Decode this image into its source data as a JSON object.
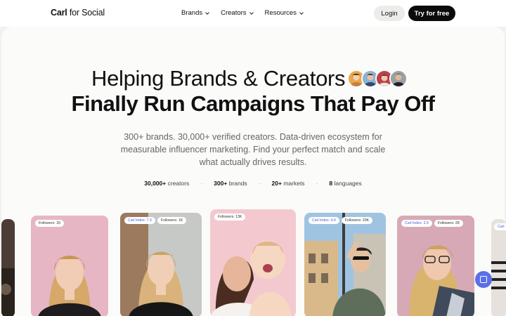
{
  "nav": {
    "logo_bold": "Carl",
    "logo_rest": "for Social",
    "menu": [
      {
        "label": "Brands"
      },
      {
        "label": "Creators"
      },
      {
        "label": "Resources"
      }
    ],
    "login_label": "Login",
    "cta_label": "Try for free"
  },
  "hero": {
    "headline_line1": "Helping Brands & Creators",
    "headline_line2": "Finally Run Campaigns That Pay Off",
    "subtitle": "300+ brands. 30,000+ verified creators. Data-driven ecosystem for measurable influencer marketing. Find your perfect match and scale what actually drives results."
  },
  "stats": [
    {
      "value": "30,000+",
      "label": "creators"
    },
    {
      "value": "300+",
      "label": "brands"
    },
    {
      "value": "20+",
      "label": "markets"
    },
    {
      "value": "8",
      "label": "languages"
    }
  ],
  "cards": [
    {
      "badges": []
    },
    {
      "badges": [
        {
          "text": "Followers: 1K"
        }
      ]
    },
    {
      "badges": [
        {
          "text": "Carl Index: 7.3"
        },
        {
          "text": "Followers: 1K"
        }
      ]
    },
    {
      "badges": [
        {
          "text": "Followers: 13K"
        }
      ]
    },
    {
      "badges": [
        {
          "text": "Carl Index: 4.4"
        },
        {
          "text": "Followers: 20K"
        }
      ]
    },
    {
      "badges": [
        {
          "text": "Carl Index: 3.9"
        },
        {
          "text": "Followers: 2K"
        }
      ]
    },
    {
      "badges": [
        {
          "text": "Carl"
        }
      ]
    }
  ],
  "colors": {
    "primary": "#0b0b0b",
    "accent": "#5b6fe6",
    "background": "#f1f1ef"
  }
}
